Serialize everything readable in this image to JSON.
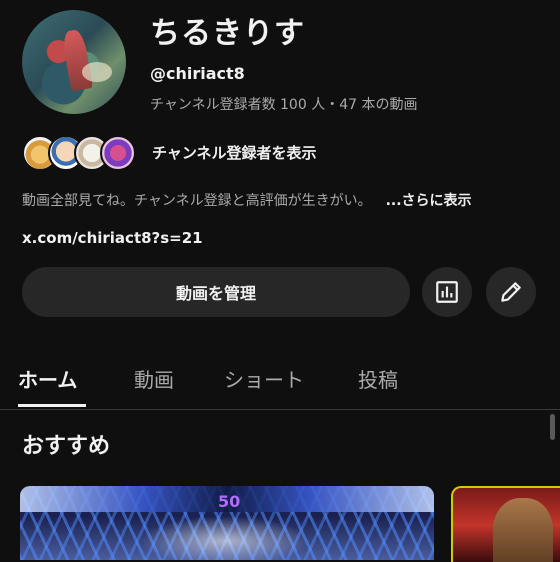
{
  "channel": {
    "name": "ちるきりす",
    "handle": "@chiriact8",
    "stats": "チャンネル登録者数 100 人・47 本の動画",
    "subscribers_label": "チャンネル登録者を表示",
    "description": "動画全部見てね。チャンネル登録と高評価が生きがい。",
    "more_label": "...さらに表示",
    "link": "x.com/chiriact8?s=21"
  },
  "actions": {
    "manage_label": "動画を管理",
    "analytics_icon": "bar-chart-icon",
    "edit_icon": "pencil-icon"
  },
  "tabs": [
    {
      "label": "ホーム",
      "active": true
    },
    {
      "label": "動画",
      "active": false
    },
    {
      "label": "ショート",
      "active": false
    },
    {
      "label": "投稿",
      "active": false
    }
  ],
  "section": {
    "title": "おすすめ"
  },
  "thumbnails": [
    {
      "overlay_text": "50"
    },
    {
      "overlay_text": ""
    }
  ],
  "colors": {
    "background": "#0f0f0f",
    "button": "#272727",
    "text": "#f1f1f1",
    "secondary_text": "#aaaaaa"
  }
}
